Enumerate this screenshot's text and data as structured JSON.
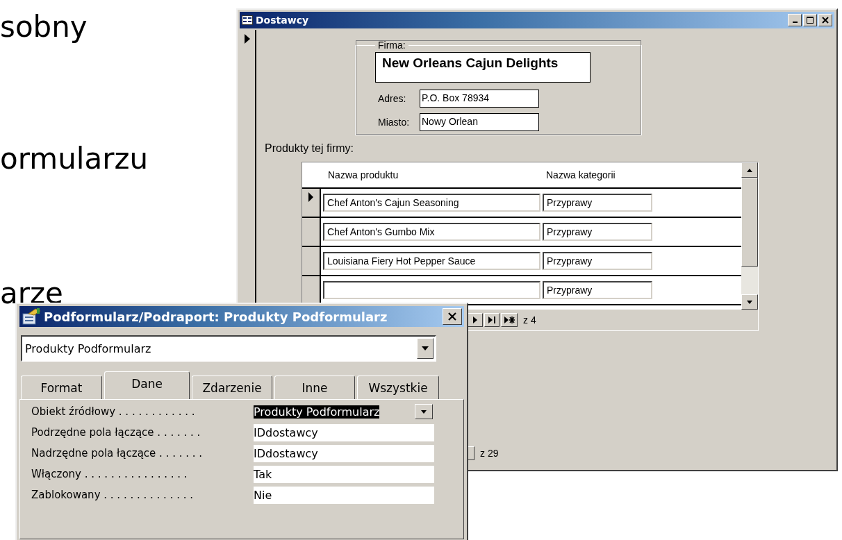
{
  "slide_text": [
    "sobny",
    "ormularzu",
    "arze"
  ],
  "main_window": {
    "title": "Dostawcy",
    "group_label": "Firma:",
    "company": "New Orleans Cajun Delights",
    "fields": [
      {
        "label": "Adres:",
        "value": "P.O. Box 78934"
      },
      {
        "label": "Miasto:",
        "value": "Nowy Orlean"
      }
    ],
    "subform_label": "Produkty tej firmy:",
    "subform": {
      "columns": [
        "Nazwa produktu",
        "Nazwa kategorii"
      ],
      "rows": [
        {
          "product": "Chef Anton's Cajun Seasoning",
          "category": "Przyprawy",
          "selected": true
        },
        {
          "product": "Chef Anton's Gumbo Mix",
          "category": "Przyprawy",
          "selected": false
        },
        {
          "product": "Louisiana Fiery Hot Pepper Sauce",
          "category": "Przyprawy",
          "selected": false
        },
        {
          "category": "Przyprawy",
          "selected": false
        }
      ],
      "record_count": "z 4"
    },
    "record_count": "z 29"
  },
  "dialog": {
    "title": "Podformularz/Podraport: Produkty Podformularz",
    "object": "Produkty Podformularz",
    "tabs": [
      {
        "label": "Format",
        "selected": false
      },
      {
        "label": "Dane",
        "selected": true
      },
      {
        "label": "Zdarzenie",
        "selected": false
      },
      {
        "label": "Inne",
        "selected": false
      },
      {
        "label": "Wszystkie",
        "selected": false
      }
    ],
    "properties": [
      {
        "label": "Obiekt źródłowy . . . . . . . . . . . .",
        "value": "Produkty Podformularz",
        "kind": "dropdown",
        "selected": true
      },
      {
        "label": "Podrzędne pola łączące . . . . . . .",
        "value": "IDdostawcy",
        "kind": "text",
        "selected": false
      },
      {
        "label": "Nadrzędne pola łączące . . . . . . .",
        "value": "IDdostawcy",
        "kind": "text",
        "selected": false
      },
      {
        "label": "Włączony . . . . . . . . . . . . . . . .",
        "value": "Tak",
        "kind": "text",
        "selected": false
      },
      {
        "label": "Zablokowany . . . . . . . . . . . . . .",
        "value": "Nie",
        "kind": "text",
        "selected": false
      }
    ]
  }
}
